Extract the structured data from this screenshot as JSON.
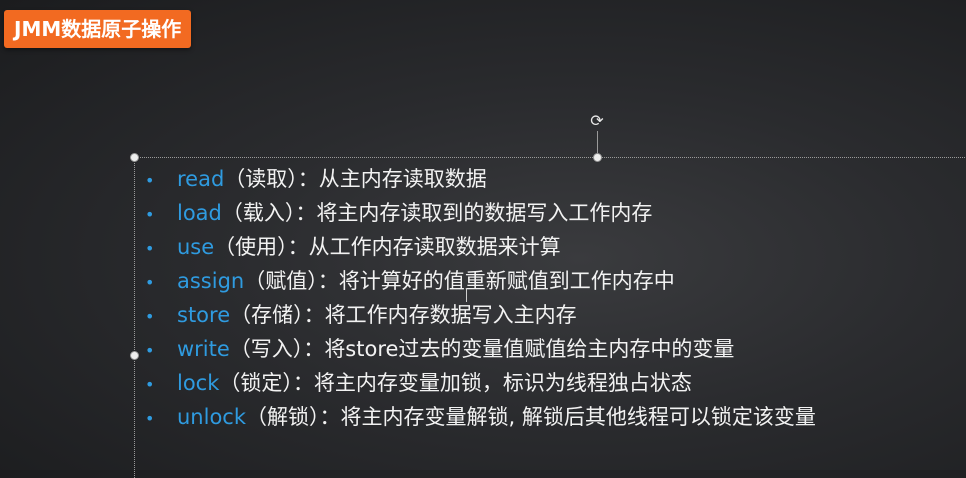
{
  "slide": {
    "title": "JMM数据原子操作"
  },
  "operations": [
    {
      "keyword": "read",
      "label": "（读取）：",
      "description": "从主内存读取数据"
    },
    {
      "keyword": "load",
      "label": "（载入）：",
      "description": "将主内存读取到的数据写入工作内存"
    },
    {
      "keyword": "use",
      "label": "（使用）：",
      "description": "从工作内存读取数据来计算"
    },
    {
      "keyword": "assign",
      "label": "（赋值）：",
      "description": "将计算好的值重新赋值到工作内存中"
    },
    {
      "keyword": "store",
      "label": "（存储）：",
      "description": "将工作内存数据写入主内存"
    },
    {
      "keyword": "write",
      "label": "（写入）：",
      "description": "将store过去的变量值赋值给主内存中的变量"
    },
    {
      "keyword": "lock",
      "label": "（锁定）：",
      "description": "将主内存变量加锁，标识为线程独占状态"
    },
    {
      "keyword": "unlock",
      "label": "（解锁）：",
      "description": "将主内存变量解锁, 解锁后其他线程可以锁定该变量"
    }
  ],
  "icons": {
    "rotate": "rotate-handle-icon",
    "bullet": "•"
  },
  "colors": {
    "title_bg": "#f26a21",
    "keyword": "#2f9be0",
    "text": "#f2f2f2",
    "background": "#2a2b2e"
  }
}
